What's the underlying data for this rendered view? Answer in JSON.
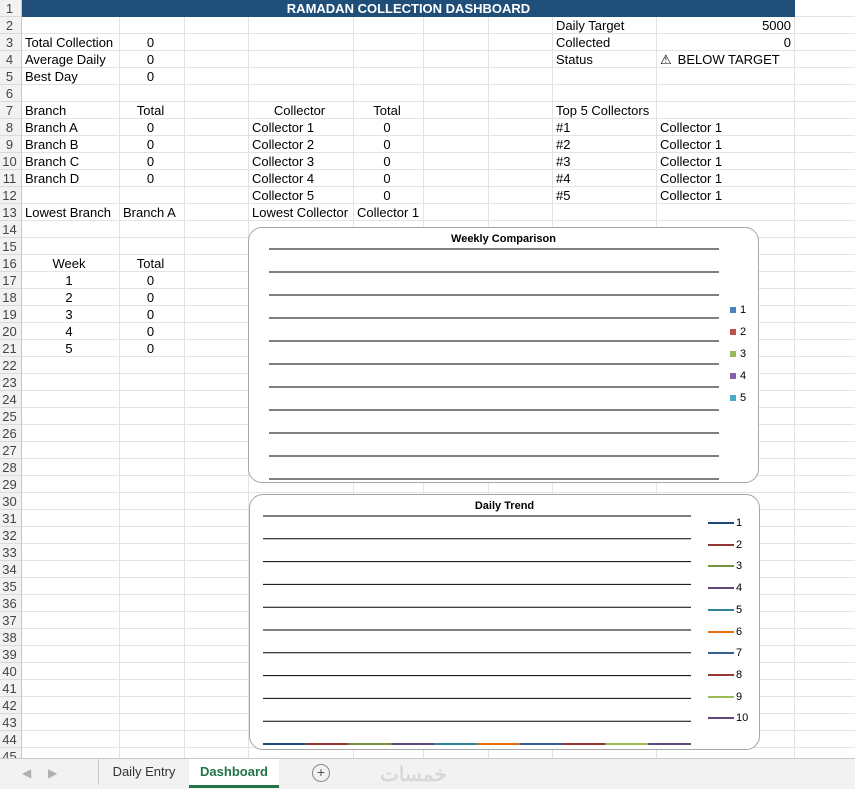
{
  "sheet": {
    "title": "RAMADAN COLLECTION DASHBOARD",
    "summary": {
      "total_collection_label": "Total Collection",
      "total_collection": "0",
      "average_daily_label": "Average Daily",
      "average_daily": "0",
      "best_day_label": "Best Day",
      "best_day": "0"
    },
    "target": {
      "daily_target_label": "Daily Target",
      "daily_target": "5000",
      "collected_label": "Collected",
      "collected": "0",
      "status_label": "Status",
      "status_icon": "warning-icon",
      "status": "BELOW TARGET"
    },
    "branches": {
      "header": [
        "Branch",
        "Total"
      ],
      "rows": [
        [
          "Branch A",
          "0"
        ],
        [
          "Branch B",
          "0"
        ],
        [
          "Branch C",
          "0"
        ],
        [
          "Branch D",
          "0"
        ]
      ],
      "lowest_label": "Lowest Branch",
      "lowest_value": "Branch A"
    },
    "collectors": {
      "header": [
        "Collector",
        "Total"
      ],
      "rows": [
        [
          "Collector 1",
          "0"
        ],
        [
          "Collector 2",
          "0"
        ],
        [
          "Collector 3",
          "0"
        ],
        [
          "Collector 4",
          "0"
        ],
        [
          "Collector 5",
          "0"
        ]
      ],
      "lowest_label": "Lowest Collector",
      "lowest_value": "Collector 1"
    },
    "top5": {
      "header": "Top 5 Collectors",
      "rows": [
        [
          "#1",
          "Collector 1"
        ],
        [
          "#2",
          "Collector 1"
        ],
        [
          "#3",
          "Collector 1"
        ],
        [
          "#4",
          "Collector 1"
        ],
        [
          "#5",
          "Collector 1"
        ]
      ]
    },
    "weeks": {
      "header": [
        "Week",
        "Total"
      ],
      "rows": [
        [
          "1",
          "0"
        ],
        [
          "2",
          "0"
        ],
        [
          "3",
          "0"
        ],
        [
          "4",
          "0"
        ],
        [
          "5",
          "0"
        ]
      ]
    }
  },
  "chart_data": [
    {
      "type": "bar",
      "title": "Weekly Comparison",
      "categories": [],
      "series": [
        {
          "name": "1",
          "color": "#4f81bd",
          "values": []
        },
        {
          "name": "2",
          "color": "#c0504d",
          "values": []
        },
        {
          "name": "3",
          "color": "#9bbb59",
          "values": []
        },
        {
          "name": "4",
          "color": "#8064a2",
          "values": []
        },
        {
          "name": "5",
          "color": "#4bacc6",
          "values": []
        }
      ],
      "grid": true,
      "legend": "right"
    },
    {
      "type": "line",
      "title": "Daily Trend",
      "x": [],
      "series": [
        {
          "name": "1",
          "color": "#1f497d",
          "values": []
        },
        {
          "name": "2",
          "color": "#943634",
          "values": []
        },
        {
          "name": "3",
          "color": "#76923c",
          "values": []
        },
        {
          "name": "4",
          "color": "#5f497a",
          "values": []
        },
        {
          "name": "5",
          "color": "#31849b",
          "values": []
        },
        {
          "name": "6",
          "color": "#e36c09",
          "values": []
        },
        {
          "name": "7",
          "color": "#366092",
          "values": []
        },
        {
          "name": "8",
          "color": "#953735",
          "values": []
        },
        {
          "name": "9",
          "color": "#9bbb59",
          "values": []
        },
        {
          "name": "10",
          "color": "#604a7b",
          "values": []
        }
      ],
      "grid": true,
      "legend": "right"
    }
  ],
  "tabs": {
    "items": [
      "Daily Entry",
      "Dashboard"
    ],
    "active": "Dashboard"
  },
  "watermark": "خمسات"
}
